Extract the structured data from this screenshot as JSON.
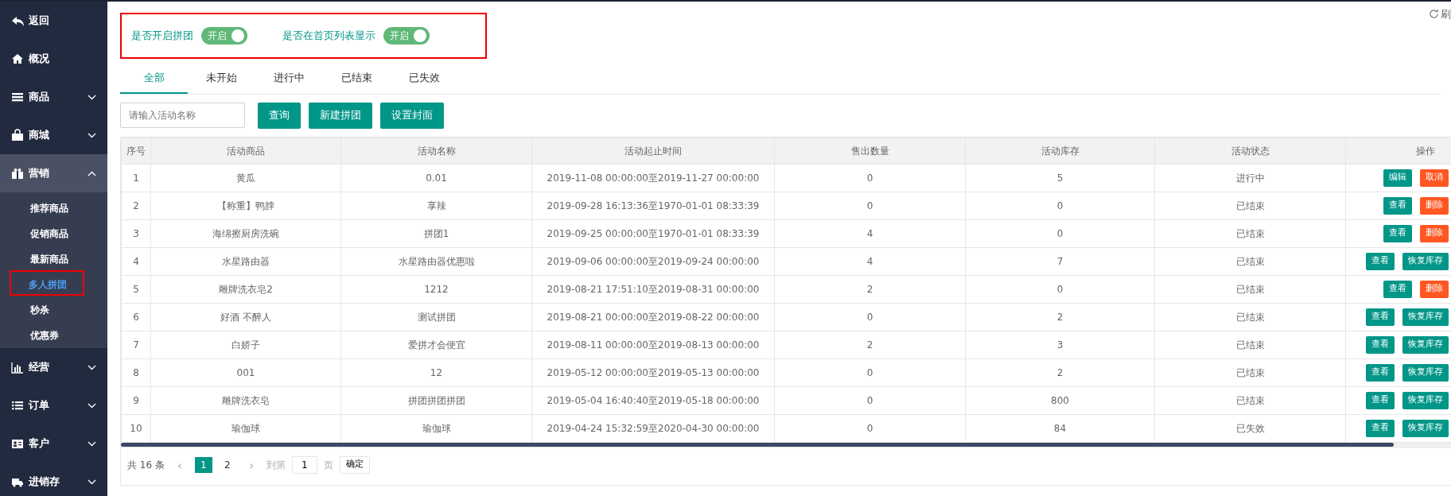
{
  "sidebar": {
    "items": [
      {
        "label": "返回",
        "expandable": false,
        "expanded": false
      },
      {
        "label": "概况",
        "expandable": false,
        "expanded": false
      },
      {
        "label": "商品",
        "expandable": true,
        "expanded": false
      },
      {
        "label": "商城",
        "expandable": true,
        "expanded": false
      },
      {
        "label": "营销",
        "expandable": true,
        "expanded": true,
        "children": [
          {
            "label": "推荐商品",
            "selected": false,
            "highlighted": false
          },
          {
            "label": "促销商品",
            "selected": false,
            "highlighted": false
          },
          {
            "label": "最新商品",
            "selected": false,
            "highlighted": false
          },
          {
            "label": "多人拼团",
            "selected": true,
            "highlighted": true
          },
          {
            "label": "秒杀",
            "selected": false,
            "highlighted": false
          },
          {
            "label": "优惠券",
            "selected": false,
            "highlighted": false
          }
        ]
      },
      {
        "label": "经营",
        "expandable": true,
        "expanded": false
      },
      {
        "label": "订单",
        "expandable": true,
        "expanded": false
      },
      {
        "label": "客户",
        "expandable": true,
        "expanded": false
      },
      {
        "label": "进销存",
        "expandable": true,
        "expanded": false
      }
    ]
  },
  "refresh": {
    "label": "刷"
  },
  "settings": {
    "highlighted": true,
    "toggles": [
      {
        "label": "是否开启拼团",
        "text": "开启",
        "on": true
      },
      {
        "label": "是否在首页列表显示",
        "text": "开启",
        "on": true
      }
    ]
  },
  "tabs": [
    {
      "label": "全部",
      "selected": true
    },
    {
      "label": "未开始",
      "selected": false
    },
    {
      "label": "进行中",
      "selected": false
    },
    {
      "label": "已结束",
      "selected": false
    },
    {
      "label": "已失效",
      "selected": false
    }
  ],
  "search": {
    "placeholder": "请输入活动名称"
  },
  "buttons": [
    "查询",
    "新建拼团",
    "设置封面"
  ],
  "table": {
    "columns": [
      "序号",
      "活动商品",
      "活动名称",
      "活动起止时间",
      "售出数量",
      "活动库存",
      "活动状态",
      "操作"
    ],
    "rows": [
      {
        "cells": [
          "1",
          "黄瓜",
          "0.01",
          "2019-11-08 00:00:00至2019-11-27 00:00:00",
          "0",
          "5",
          "进行中"
        ],
        "actions": [
          {
            "label": "编辑",
            "kind": "primary"
          },
          {
            "label": "取消",
            "kind": "danger"
          }
        ]
      },
      {
        "cells": [
          "2",
          "【称重】鸭脖",
          "享辣",
          "2019-09-28 16:13:36至1970-01-01 08:33:39",
          "0",
          "0",
          "已结束"
        ],
        "actions": [
          {
            "label": "查看",
            "kind": "primary"
          },
          {
            "label": "删除",
            "kind": "danger"
          }
        ]
      },
      {
        "cells": [
          "3",
          "海绵擦厨房洗碗",
          "拼团1",
          "2019-09-25 00:00:00至1970-01-01 08:33:39",
          "4",
          "0",
          "已结束"
        ],
        "actions": [
          {
            "label": "查看",
            "kind": "primary"
          },
          {
            "label": "删除",
            "kind": "danger"
          }
        ]
      },
      {
        "cells": [
          "4",
          "水星路由器",
          "水星路由器优惠啦",
          "2019-09-06 00:00:00至2019-09-24 00:00:00",
          "4",
          "7",
          "已结束"
        ],
        "actions": [
          {
            "label": "查看",
            "kind": "primary"
          },
          {
            "label": "恢复库存",
            "kind": "primary"
          }
        ]
      },
      {
        "cells": [
          "5",
          "雕牌洗衣皂2",
          "1212",
          "2019-08-21 17:51:10至2019-08-31 00:00:00",
          "2",
          "0",
          "已结束"
        ],
        "actions": [
          {
            "label": "查看",
            "kind": "primary"
          },
          {
            "label": "删除",
            "kind": "danger"
          }
        ]
      },
      {
        "cells": [
          "6",
          "好酒 不醉人",
          "测试拼团",
          "2019-08-21 00:00:00至2019-08-22 00:00:00",
          "0",
          "2",
          "已结束"
        ],
        "actions": [
          {
            "label": "查看",
            "kind": "primary"
          },
          {
            "label": "恢复库存",
            "kind": "primary"
          }
        ]
      },
      {
        "cells": [
          "7",
          "白娇子",
          "爱拼才会便宜",
          "2019-08-11 00:00:00至2019-08-13 00:00:00",
          "2",
          "3",
          "已结束"
        ],
        "actions": [
          {
            "label": "查看",
            "kind": "primary"
          },
          {
            "label": "恢复库存",
            "kind": "primary"
          }
        ]
      },
      {
        "cells": [
          "8",
          "001",
          "12",
          "2019-05-12 00:00:00至2019-05-13 00:00:00",
          "0",
          "2",
          "已结束"
        ],
        "actions": [
          {
            "label": "查看",
            "kind": "primary"
          },
          {
            "label": "恢复库存",
            "kind": "primary"
          }
        ]
      },
      {
        "cells": [
          "9",
          "雕牌洗衣皂",
          "拼团拼团拼团",
          "2019-05-04 16:40:40至2019-05-18 00:00:00",
          "0",
          "800",
          "已结束"
        ],
        "actions": [
          {
            "label": "查看",
            "kind": "primary"
          },
          {
            "label": "恢复库存",
            "kind": "primary"
          }
        ]
      },
      {
        "cells": [
          "10",
          "瑜伽球",
          "瑜伽球",
          "2019-04-24 15:32:59至2020-04-30 00:00:00",
          "0",
          "84",
          "已失效"
        ],
        "actions": [
          {
            "label": "查看",
            "kind": "primary"
          },
          {
            "label": "恢复库存",
            "kind": "primary"
          }
        ]
      }
    ]
  },
  "pagination": {
    "total": "共 16 条",
    "prev": "‹",
    "pages": [
      {
        "label": "1",
        "selected": true
      },
      {
        "label": "2",
        "selected": false
      }
    ],
    "next": "›",
    "goto_label": "到第",
    "goto_value": "1",
    "page_unit": "页",
    "confirm": "确定"
  }
}
